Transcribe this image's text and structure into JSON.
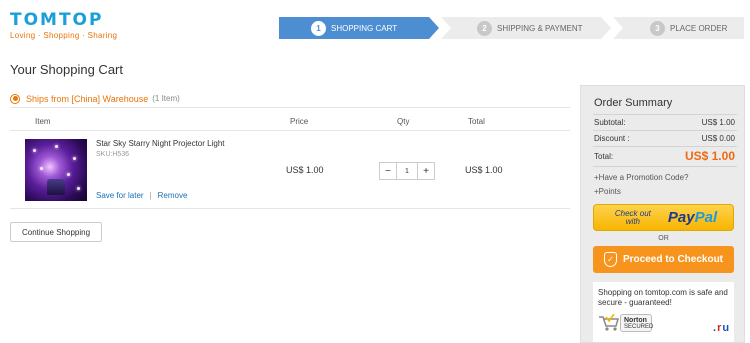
{
  "brand": {
    "name": "TOMTOP",
    "tagline": "Loving · Shopping · Sharing"
  },
  "steps": [
    {
      "num": "1",
      "label": "SHOPPING CART"
    },
    {
      "num": "2",
      "label": "SHIPPING & PAYMENT"
    },
    {
      "num": "3",
      "label": "PLACE ORDER"
    }
  ],
  "page": {
    "title": "Your Shopping Cart"
  },
  "cart": {
    "ships_from": "Ships from [China] Warehouse",
    "item_count": "(1 Item)",
    "headers": {
      "item": "Item",
      "price": "Price",
      "qty": "Qty",
      "total": "Total"
    },
    "items": [
      {
        "name": "Star Sky Starry Night Projector Light",
        "sku": "SKU:H536",
        "price": "US$ 1.00",
        "qty": "1",
        "total": "US$ 1.00",
        "save_label": "Save for later",
        "separator": "|",
        "remove_label": "Remove"
      }
    ],
    "continue_label": "Continue Shopping"
  },
  "summary": {
    "title": "Order Summary",
    "subtotal_label": "Subtotal:",
    "subtotal_value": "US$ 1.00",
    "discount_label": "Discount :",
    "discount_value": "US$ 0.00",
    "total_label": "Total:",
    "total_value": "US$ 1.00",
    "promo_link": "+Have a Promotion Code?",
    "points_link": "+Points",
    "paypal_checkout": "Check out with",
    "paypal_pay": "Pay",
    "paypal_pal": "Pal",
    "or": "OR",
    "proceed_label": "Proceed to Checkout",
    "secure_text": "Shopping on tomtop.com is safe and secure - guaranteed!",
    "norton_name": "Norton",
    "norton_sub": "SECURED"
  },
  "watermark": {
    "a": ".",
    "b": "r",
    "c": "u"
  },
  "colors": {
    "brand_blue": "#1aa0d8",
    "accent_orange": "#f7941d",
    "step_active": "#4d8ed3",
    "link": "#1a6fb4"
  }
}
